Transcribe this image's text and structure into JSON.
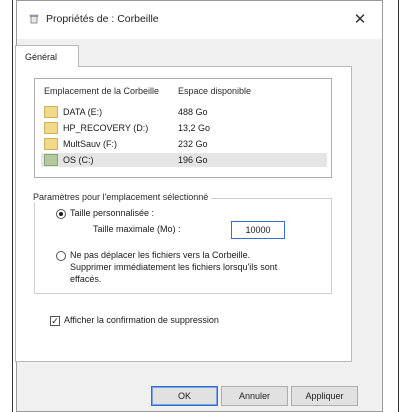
{
  "window": {
    "title": "Propriétés de : Corbeille",
    "close_glyph": "✕"
  },
  "tabs": [
    {
      "label": "Général"
    }
  ],
  "list": {
    "columns": {
      "location": "Emplacement de la Corbeille",
      "space": "Espace disponible"
    },
    "rows": [
      {
        "name": "DATA (E:)",
        "space": "488 Go"
      },
      {
        "name": "HP_RECOVERY (D:)",
        "space": "13,2 Go"
      },
      {
        "name": "MultSauv (F:)",
        "space": "232 Go"
      },
      {
        "name": "OS (C:)",
        "space": "196 Go"
      }
    ]
  },
  "settings": {
    "group_label": "Paramètres pour l'emplacement sélectionné",
    "custom_size_label": "Taille personnalisée :",
    "max_size_label": "Taille maximale (Mo) :",
    "max_size_value": "10000",
    "no_recycle_line1": "Ne pas déplacer les fichiers vers la Corbeille.",
    "no_recycle_line2": "Supprimer immédiatement les fichiers lorsqu'ils sont",
    "no_recycle_line3": "effacés.",
    "confirm_label": "Afficher la confirmation de suppression"
  },
  "buttons": {
    "ok": "OK",
    "cancel": "Annuler",
    "apply": "Appliquer"
  }
}
